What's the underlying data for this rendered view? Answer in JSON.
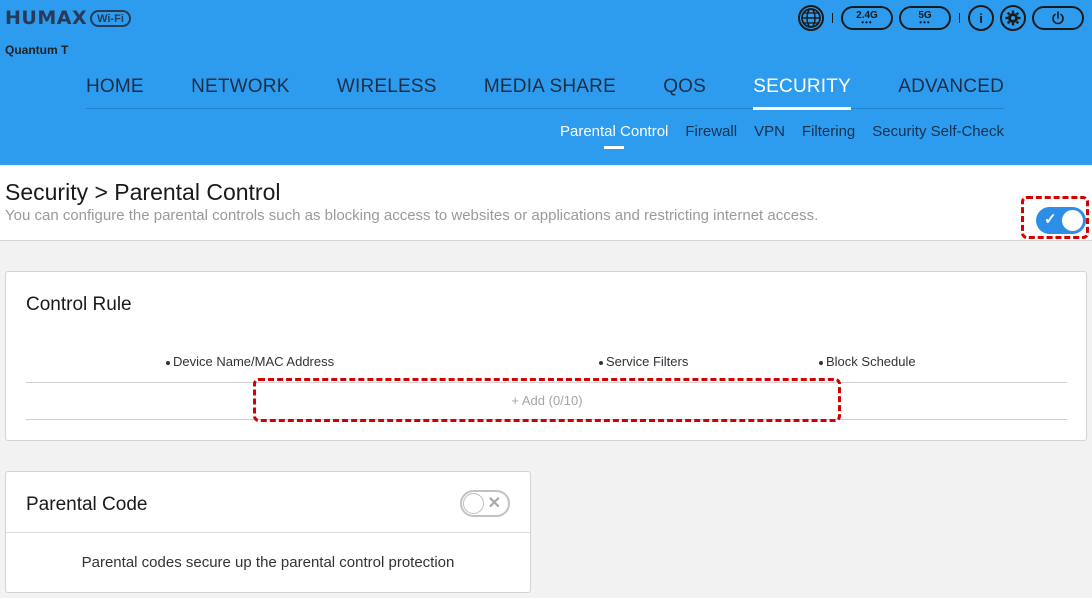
{
  "header": {
    "brand": "HUMAX",
    "wifi_badge": "Wi-Fi",
    "model": "Quantum T",
    "band_24": "2.4G",
    "band_5": "5G",
    "band_dots": "•••",
    "info_glyph": "i",
    "icons": [
      "globe-icon",
      "info-icon",
      "gear-icon",
      "power-icon"
    ]
  },
  "main_nav": [
    {
      "label": "HOME"
    },
    {
      "label": "NETWORK"
    },
    {
      "label": "WIRELESS"
    },
    {
      "label": "MEDIA SHARE"
    },
    {
      "label": "QOS"
    },
    {
      "label": "SECURITY"
    },
    {
      "label": "ADVANCED"
    }
  ],
  "sub_nav": [
    {
      "label": "Parental Control"
    },
    {
      "label": "Firewall"
    },
    {
      "label": "VPN"
    },
    {
      "label": "Filtering"
    },
    {
      "label": "Security Self-Check"
    }
  ],
  "page": {
    "title": "Security > Parental Control",
    "description": "You can configure the parental controls such as blocking access to websites or applications and restricting internet access.",
    "enabled": true
  },
  "control_rule": {
    "title": "Control Rule",
    "columns": [
      "Device Name/MAC Address",
      "Service Filters",
      "Block Schedule"
    ],
    "add_label": "+ Add (0/10)"
  },
  "parental_code": {
    "title": "Parental Code",
    "enabled": false,
    "description": "Parental codes secure up the parental control protection"
  },
  "colors": {
    "header_bg": "#2d9cef",
    "active_toggle": "#2d8ee8",
    "highlight": "#d30000"
  }
}
